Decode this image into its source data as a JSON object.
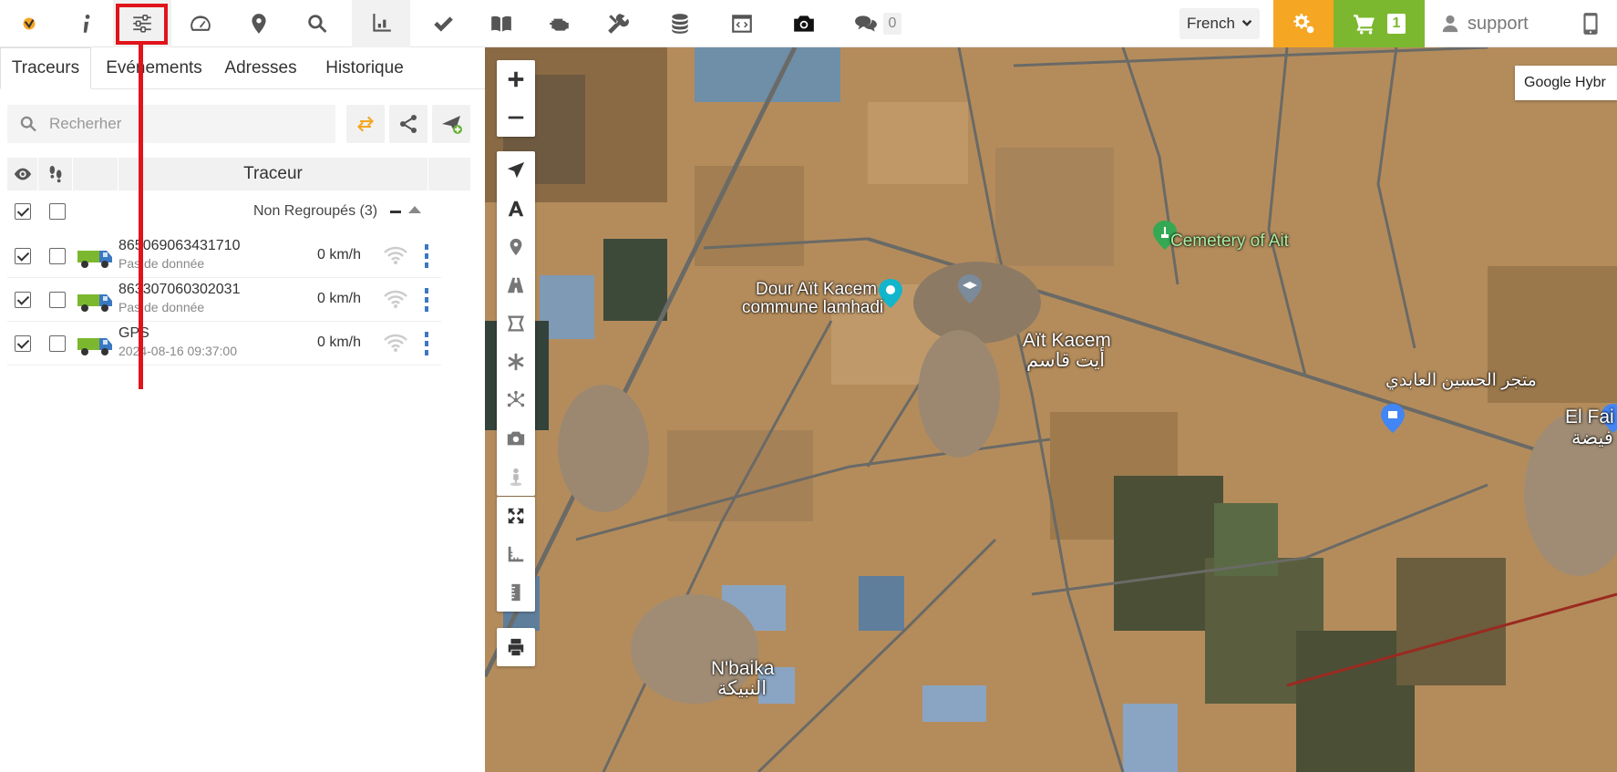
{
  "toolbar": {
    "icons": [
      "logo-icon",
      "info-icon",
      "settings-sliders-icon",
      "speedometer-icon",
      "map-pin-icon",
      "zoom-search-icon",
      "chart-axes-icon",
      "checkmark-icon",
      "book-icon",
      "engine-icon",
      "tools-icon",
      "database-icon",
      "code-window-icon",
      "camera-icon",
      "chat-icon"
    ],
    "chat_count": "0",
    "language": "French",
    "cart_count": "1",
    "user": "support"
  },
  "tabs": [
    "Traceurs",
    "Evénements",
    "Adresses",
    "Historique"
  ],
  "search": {
    "placeholder": "Recherher"
  },
  "table": {
    "header": "Traceur"
  },
  "group": {
    "label": "Non Regroupés (3)"
  },
  "trackers": [
    {
      "name": "865069063431710",
      "sub": "Pas de donnée",
      "speed": "0 km/h"
    },
    {
      "name": "863307060302031",
      "sub": "Pas de donnée",
      "speed": "0 km/h"
    },
    {
      "name": "GPS",
      "sub": "2024-08-16 09:37:00",
      "speed": "0 km/h"
    }
  ],
  "map": {
    "type_label": "Google Hybr",
    "labels": {
      "cemetery": "Cemetery of Ait",
      "dour1": "Dour Aït Kacem",
      "dour2": "commune lamhadi",
      "ait1": "Aït Kacem",
      "ait2": "أيت قاسم",
      "shop": "متجر الحسين العابدي",
      "elfa1": "El Fai",
      "elfa2": "فيضة",
      "nbaika1": "N'baika",
      "nbaika2": "النبيكة"
    }
  },
  "colors": {
    "accent_orange": "#f5a623",
    "accent_green": "#7cb82f",
    "annotation_red": "#e0141a"
  }
}
